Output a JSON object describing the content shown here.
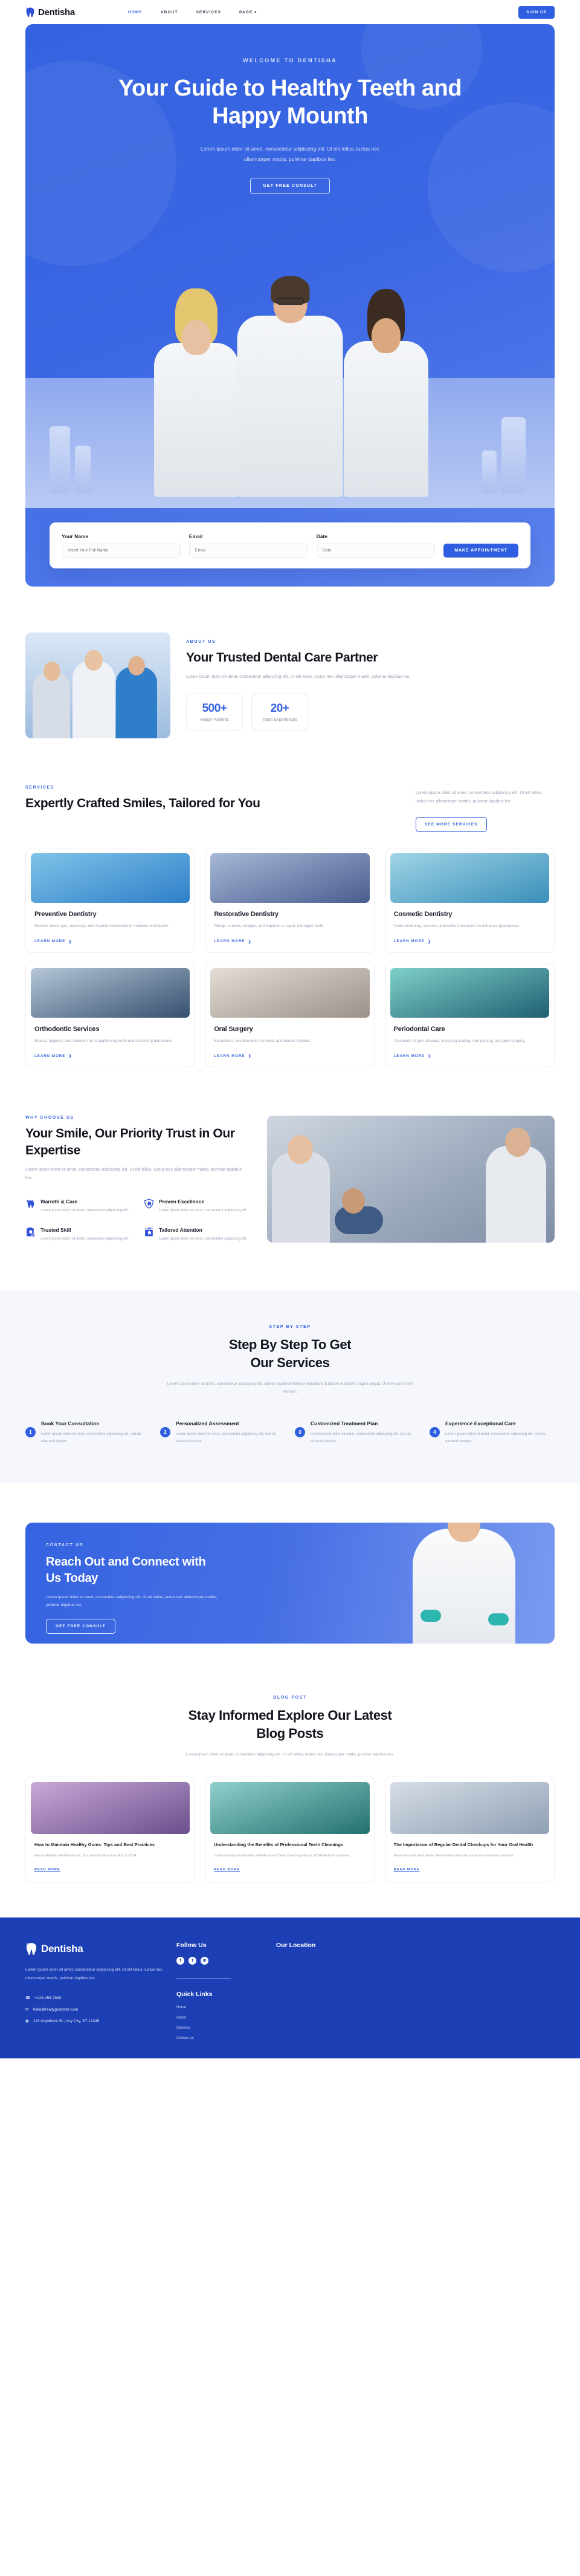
{
  "brand": {
    "name": "Dentisha",
    "logo_icon": "tooth-icon"
  },
  "nav": {
    "items": [
      {
        "label": "HOME",
        "active": true
      },
      {
        "label": "ABOUT",
        "active": false
      },
      {
        "label": "SERVICES",
        "active": false
      },
      {
        "label": "PAGE",
        "active": false,
        "has_dropdown": true
      }
    ],
    "signup_label": "SIGN UP"
  },
  "hero": {
    "eyebrow": "WELCOME TO DENTISHA",
    "title_line1": "Your Guide to Healthy Teeth and",
    "title_line2": "Happy Mounth",
    "paragraph": "Lorem ipsum dolor sit amet, consectetur adipiscing elit. Ut elit tellus, luctus nec ullamcorper mattis, pulvinar dapibus leo.",
    "cta_label": "GET FREE CONSULT",
    "accent_color": "#3563e0"
  },
  "appointment": {
    "fields": [
      {
        "label": "Your Name",
        "value": "",
        "placeholder": "Insert Your Full Name"
      },
      {
        "label": "Email",
        "value": "",
        "placeholder": "Email"
      },
      {
        "label": "Date",
        "value": "",
        "placeholder": "Date"
      }
    ],
    "submit_label": "MAKE APPOINTMENT"
  },
  "about": {
    "eyebrow": "ABOUT US",
    "title": "Your Trusted Dental Care Partner",
    "paragraph": "Lorem ipsum dolor sit amet, consectetur adipiscing elit. Ut elit tellus, luctus nec ullamcorper mattis, pulvinar dapibus leo.",
    "stats": [
      {
        "number": "500+",
        "label": "Happy Patients"
      },
      {
        "number": "20+",
        "label": "Years Experiences"
      }
    ]
  },
  "services": {
    "eyebrow": "SERVICES",
    "title": "Expertly Crafted Smiles, Tailored for You",
    "paragraph": "Lorem ipsum dolor sit amet, consectetur adipiscing elit. Ut elit tellus, luctus nec ullamcorper mattis, pulvinar dapibus leo.",
    "more_label": "SEE MORE SERVICES",
    "learn_label": "LEARN MORE",
    "cards": [
      {
        "title": "Preventive Dentistry",
        "desc": "Routine check-ups, cleanings, and fluoride treatments to maintain oral health."
      },
      {
        "title": "Restorative Dentistry",
        "desc": "Fillings, crowns, bridges, and implants to repair damaged teeth."
      },
      {
        "title": "Cosmetic Dentistry",
        "desc": "Teeth whitening, veneers, and smile makeovers to enhance appearance."
      },
      {
        "title": "Orthodontic Services",
        "desc": "Braces, aligners, and retainers for straightening teeth and correcting bite issues."
      },
      {
        "title": "Oral Surgery",
        "desc": "Extractions, wisdom teeth removal, and dental implants."
      },
      {
        "title": "Periodontal Care",
        "desc": "Treatment of gum disease, including scaling, root planing, and gum surgery."
      }
    ]
  },
  "why": {
    "eyebrow": "WHY CHOOSE US",
    "title": "Your Smile, Our Priority Trust in Our Expertise",
    "paragraph": "Lorem ipsum dolor sit amet, consectetur adipiscing elit. Ut elit tellus, luctus nec ullamcorper mattis, pulvinar dapibus leo.",
    "features": [
      {
        "title": "Warmth & Care",
        "desc": "Lorem ipsum dolor sit amet, consectetur adipiscing elit.",
        "icon": "sparkle-tooth-icon"
      },
      {
        "title": "Proven Excellence",
        "desc": "Lorem ipsum dolor sit amet, consectetur adipiscing elit.",
        "icon": "shield-tooth-icon"
      },
      {
        "title": "Trusted Skill",
        "desc": "Lorem ipsum dolor sit amet, consectetur adipiscing elit.",
        "icon": "clipboard-tooth-icon"
      },
      {
        "title": "Tailored Attention",
        "desc": "Lorem ipsum dolor sit amet, consectetur adipiscing elit.",
        "icon": "toothpaste-tooth-icon"
      }
    ]
  },
  "steps": {
    "eyebrow": "STEP BY STEP",
    "title_line1": "Step By Step To Get",
    "title_line2": "Our Services",
    "paragraph": "Lorem ipsum dolor sit amet, consectetur adipiscing elit, sed do eiusmod tempor incididunt ut labore et dolore magna aliqua. Ut enim ad minim veniam,",
    "items": [
      {
        "number": "1",
        "title": "Book Your Consultation",
        "desc": "Lorem ipsum dolor sit amet, consectetur adipiscing elit, sed do eiusmod tempor."
      },
      {
        "number": "2",
        "title": "Personalized Assessment",
        "desc": "Lorem ipsum dolor sit amet, consectetur adipiscing elit, sed do eiusmod tempor."
      },
      {
        "number": "3",
        "title": "Customized Treatment Plan",
        "desc": "Lorem ipsum dolor sit amet, consectetur adipiscing elit, sed do eiusmod tempor."
      },
      {
        "number": "4",
        "title": "Experience Exceptional Care",
        "desc": "Lorem ipsum dolor sit amet, consectetur adipiscing elit, sed do eiusmod tempor."
      }
    ]
  },
  "contact": {
    "eyebrow": "CONTACT US",
    "title": "Reach Out and Connect with Us Today",
    "paragraph": "Lorem ipsum dolor sit amet, consectetur adipiscing elit. Ut elit tellus, luctus nec ullamcorper mattis, pulvinar dapibus leo.",
    "cta_label": "GET FREE CONSULT"
  },
  "blog": {
    "eyebrow": "BLOG POST",
    "title_line1": "Stay Informed Explore Our Latest",
    "title_line2": "Blog Posts",
    "paragraph": "Lorem ipsum dolor sit amet, consectetur adipiscing elit. Ut elit tellus, luctus nec ullamcorper mattis, pulvinar dapibus leo.",
    "read_label": "READ MORE",
    "posts": [
      {
        "title": "How to Maintain Healthy Gums: Tips and Best Practices",
        "meta": "How to Maintain Healthy Gums: Tips and Best Practices May 5, 2024."
      },
      {
        "title": "Understanding the Benefits of Professional Teeth Cleanings",
        "meta": "Understanding the Benefits of Professional Teeth Cleanings May 5, 2024 Dental Procedures."
      },
      {
        "title": "The Importance of Regular Dental Checkups for Your Oral Health",
        "meta": "Preventive oral what will be. Preventative dentistry and home essentials consejos."
      }
    ]
  },
  "footer": {
    "brand": "Dentisha",
    "about": "Lorem ipsum dolor sit amet, consectetur adipiscing elit. Ut elit tellus, luctus nec ullamcorper mattis, pulvinar dapibus leo.",
    "contacts": [
      {
        "icon": "phone-icon",
        "text": "+123-456-7890"
      },
      {
        "icon": "mail-icon",
        "text": "hello@reallygreatsite.com"
      },
      {
        "icon": "pin-icon",
        "text": "123 Anywhere St., Any City, ST 12345"
      }
    ],
    "follow_title": "Follow Us",
    "socials": [
      {
        "name": "facebook-icon",
        "glyph": "f"
      },
      {
        "name": "twitter-icon",
        "glyph": "t"
      },
      {
        "name": "linkedin-icon",
        "glyph": "in"
      }
    ],
    "quick_title": "Quick Links",
    "quick_links": [
      "Home",
      "About",
      "Services",
      "Contact us"
    ],
    "location_title": "Our Location"
  }
}
